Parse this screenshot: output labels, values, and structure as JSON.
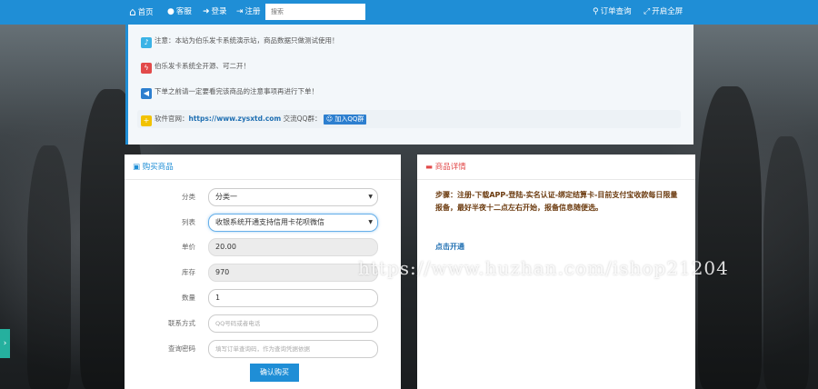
{
  "navbar": {
    "home_label": "首页",
    "service_label": "客服",
    "login_label": "登录",
    "register_label": "注册",
    "search_placeholder": "搜索",
    "order_query_label": "订单查询",
    "fullscreen_label": "开启全屏"
  },
  "notices": [
    {
      "icon": "bell-icon",
      "color": "#3bb3e6",
      "text": "注意：本站为伯乐发卡系统演示站，商品数据只做测试使用！"
    },
    {
      "icon": "lightning-icon",
      "color": "#e24a4a",
      "text": "伯乐发卡系统全开源、可二开！"
    },
    {
      "icon": "megaphone-icon",
      "color": "#2d7fcf",
      "text": "下单之前请一定要看完该商品的注意事项再进行下单！"
    }
  ],
  "site_row": {
    "icon_color": "#f2c200",
    "label": "软件官网：",
    "url": "https://www.zysxtd.com",
    "qq_label": "交流QQ群：",
    "qq_button": "加入QQ群"
  },
  "buy_panel": {
    "title": "购买商品",
    "fields": [
      {
        "label": "分类",
        "value": "分类一",
        "type": "select"
      },
      {
        "label": "列表",
        "value": "收银系统开通支持信用卡花呗微信",
        "type": "select"
      },
      {
        "label": "单价",
        "value": "20.00",
        "type": "readonly"
      },
      {
        "label": "库存",
        "value": "970",
        "type": "readonly"
      },
      {
        "label": "数量",
        "value": "1",
        "type": "input"
      },
      {
        "label": "联系方式",
        "placeholder": "QQ号码或者电话",
        "type": "input"
      },
      {
        "label": "查询密码",
        "placeholder": "填写订单查询码，作为查询凭据依据",
        "type": "input"
      }
    ],
    "submit_label": "确认购买"
  },
  "detail_panel": {
    "title": "商品详情",
    "steps": "步骤：注册-下载APP-登陆-实名认证-绑定结算卡-目前支付宝收款每日限量报备，最好半夜十二点左右开始，报备信息随便选。",
    "link_label": "点击开通"
  },
  "watermark": "https://www.huzhan.com/ishop21204",
  "colors": {
    "brand": "#1f8ed6",
    "side_toggle": "#25b09e"
  }
}
